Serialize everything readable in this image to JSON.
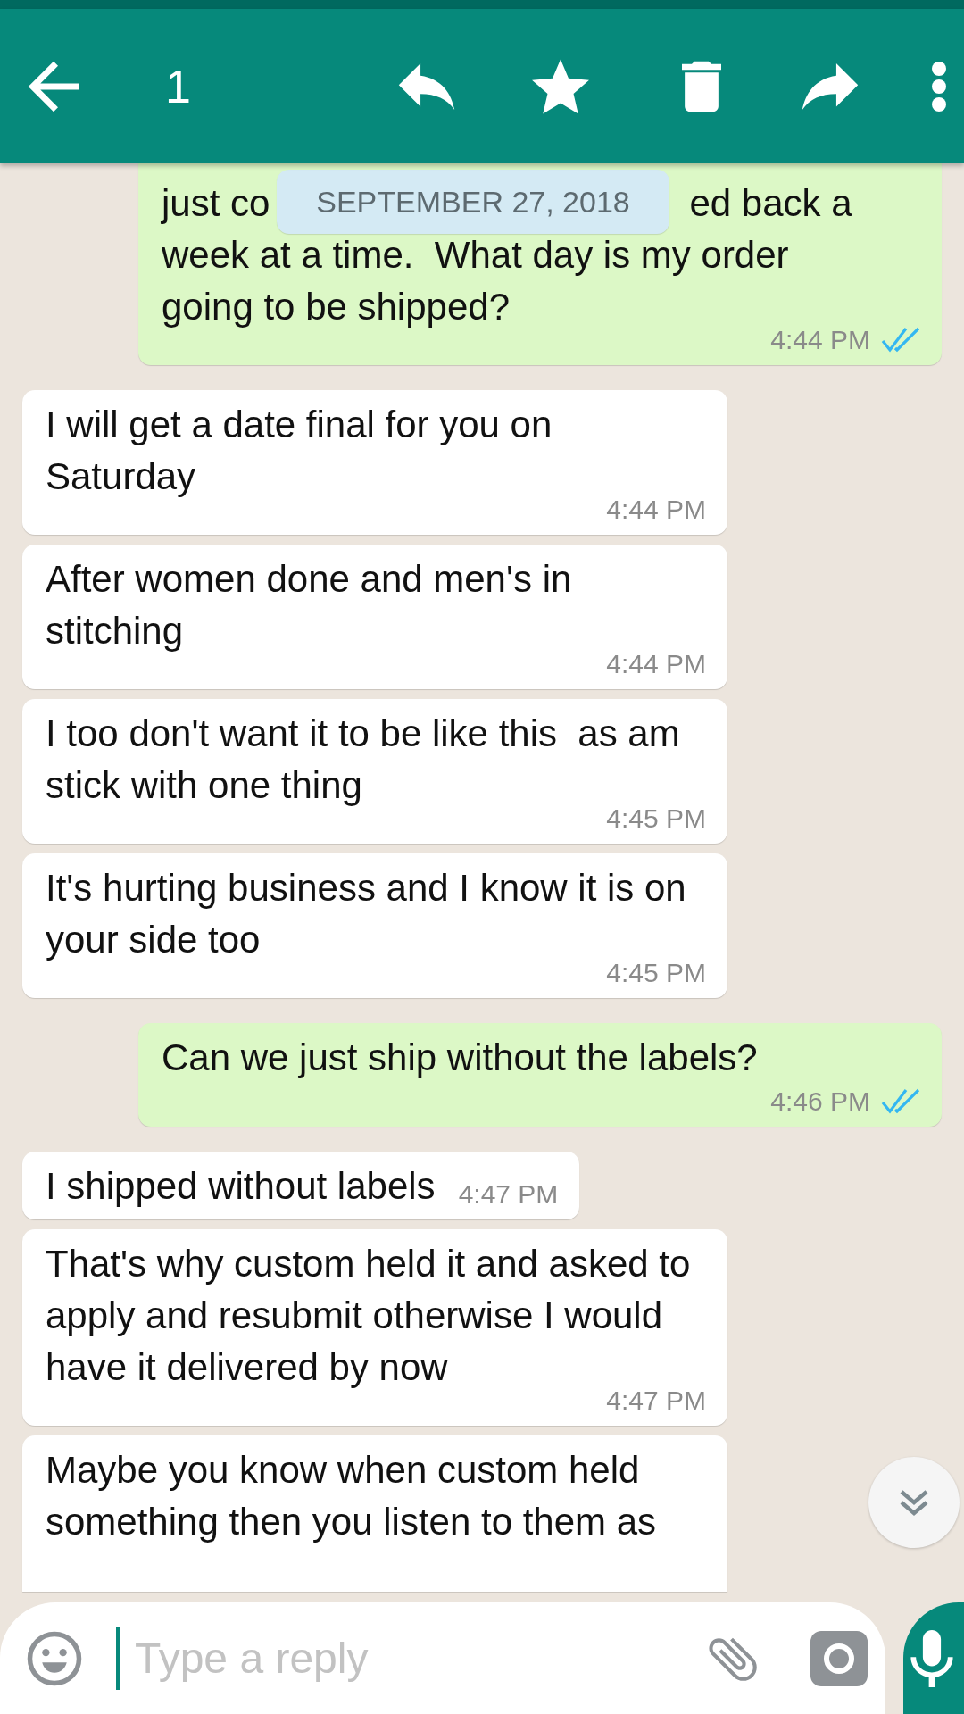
{
  "toolbar": {
    "selected_count": "1"
  },
  "date_chip": "SEPTEMBER 27, 2018",
  "messages": [
    {
      "kind": "outgoing",
      "fragments": [
        "just co",
        "ed back a"
      ],
      "text": "week at a time.  What day is my order going to be shipped?",
      "time": "4:44 PM",
      "read": true
    },
    {
      "kind": "incoming",
      "text": "I will get a date final for you on Saturday",
      "time": "4:44 PM"
    },
    {
      "kind": "incoming",
      "text": "After women done and men's in stitching",
      "time": "4:44 PM"
    },
    {
      "kind": "incoming",
      "text": "I too don't want it to be like this  as am stick with one thing",
      "time": "4:45 PM"
    },
    {
      "kind": "incoming",
      "text": "It's hurting business and I know it is on your side too",
      "time": "4:45 PM"
    },
    {
      "kind": "outgoing",
      "text": "Can we just ship without the labels?",
      "time": "4:46 PM",
      "read": true
    },
    {
      "kind": "incoming",
      "text": "I shipped without labels",
      "time": "4:47 PM"
    },
    {
      "kind": "incoming",
      "text": "That's why custom held it and asked to apply and resubmit otherwise I would have it delivered by now",
      "time": "4:47 PM"
    },
    {
      "kind": "incoming",
      "text": "Maybe you know when custom held something then you listen to them as",
      "cut": true
    }
  ],
  "composer": {
    "placeholder": "Type a reply"
  }
}
